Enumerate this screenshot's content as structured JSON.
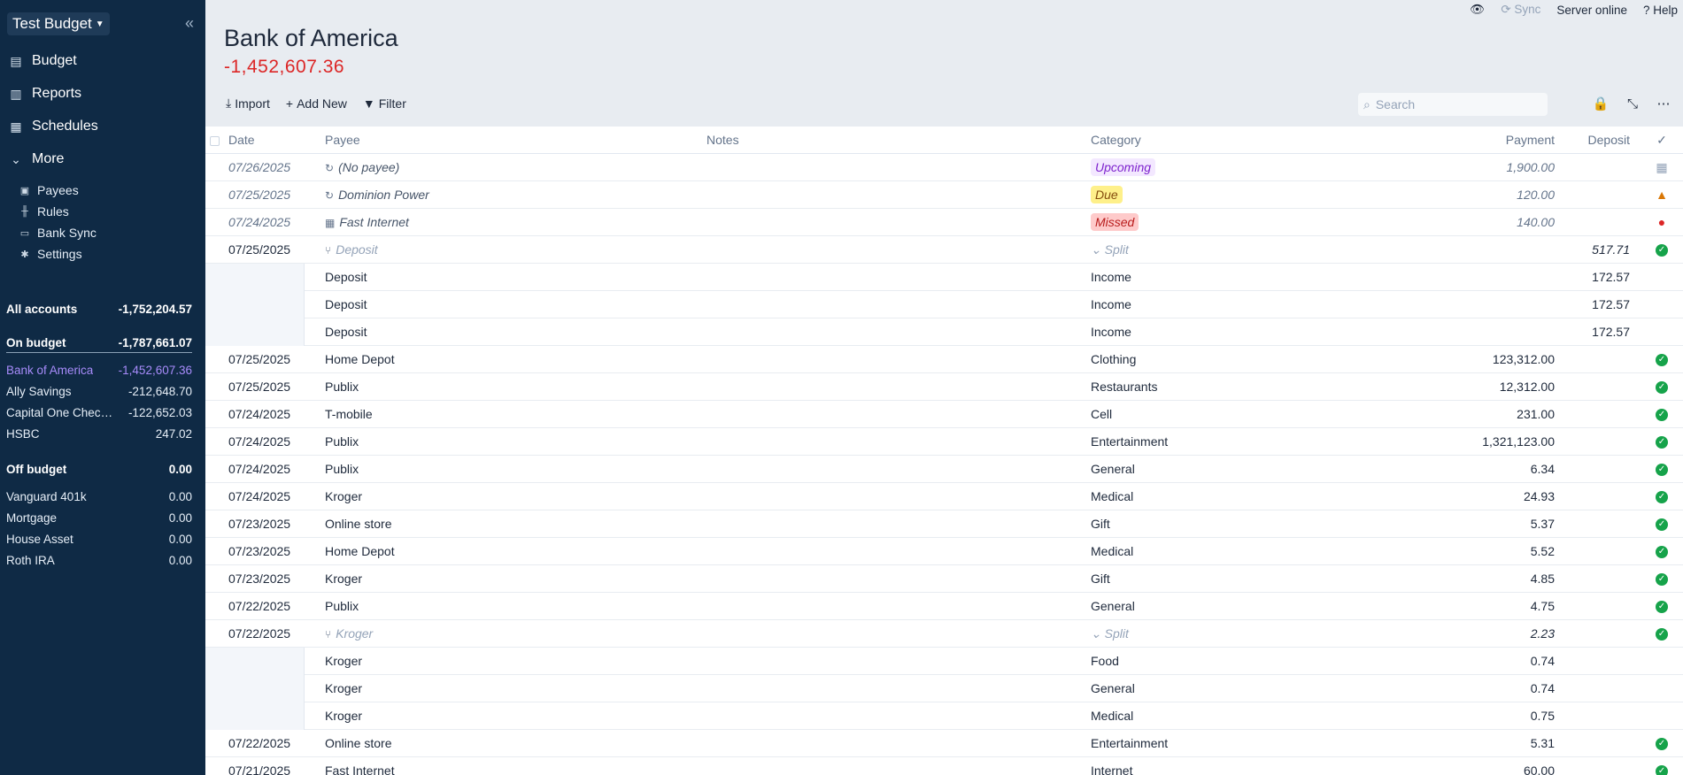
{
  "sidebar": {
    "budget_name": "Test Budget",
    "nav": [
      {
        "label": "Budget",
        "icon": "wallet-icon"
      },
      {
        "label": "Reports",
        "icon": "bar-chart-icon"
      },
      {
        "label": "Schedules",
        "icon": "calendar-icon"
      },
      {
        "label": "More",
        "icon": "chevron-down-icon"
      }
    ],
    "more_items": [
      {
        "label": "Payees",
        "icon": "payee-book-icon"
      },
      {
        "label": "Rules",
        "icon": "sliders-icon"
      },
      {
        "label": "Bank Sync",
        "icon": "credit-card-icon"
      },
      {
        "label": "Settings",
        "icon": "gear-icon"
      }
    ],
    "all_accounts": {
      "label": "All accounts",
      "value": "-1,752,204.57"
    },
    "on_budget": {
      "label": "On budget",
      "value": "-1,787,661.07"
    },
    "on_budget_accounts": [
      {
        "name": "Bank of America",
        "value": "-1,452,607.36"
      },
      {
        "name": "Ally Savings",
        "value": "-212,648.70"
      },
      {
        "name": "Capital One Checking",
        "value": "-122,652.03"
      },
      {
        "name": "HSBC",
        "value": "247.02"
      }
    ],
    "off_budget": {
      "label": "Off budget",
      "value": "0.00"
    },
    "off_budget_accounts": [
      {
        "name": "Vanguard 401k",
        "value": "0.00"
      },
      {
        "name": "Mortgage",
        "value": "0.00"
      },
      {
        "name": "House Asset",
        "value": "0.00"
      },
      {
        "name": "Roth IRA",
        "value": "0.00"
      }
    ]
  },
  "topbar": {
    "sync": "Sync",
    "server": "Server online",
    "help": "Help"
  },
  "account": {
    "title": "Bank of America",
    "balance": "-1,452,607.36"
  },
  "toolbar": {
    "import": "Import",
    "add_new": "Add New",
    "filter": "Filter",
    "search_placeholder": "Search"
  },
  "columns": {
    "date": "Date",
    "payee": "Payee",
    "notes": "Notes",
    "category": "Category",
    "payment": "Payment",
    "deposit": "Deposit",
    "cleared": "✓"
  },
  "rows": [
    {
      "kind": "sched",
      "date": "07/26/2025",
      "payee": "(No payee)",
      "pico": "↻",
      "cat_pill": "Upcoming",
      "pill_class": "upcoming",
      "payment": "1,900.00",
      "deposit": "",
      "status": "cal"
    },
    {
      "kind": "sched",
      "date": "07/25/2025",
      "payee": "Dominion Power",
      "pico": "↻",
      "cat_pill": "Due",
      "pill_class": "due",
      "payment": "120.00",
      "deposit": "",
      "status": "warn"
    },
    {
      "kind": "sched",
      "date": "07/24/2025",
      "payee": "Fast Internet",
      "pico": "▦",
      "cat_pill": "Missed",
      "pill_class": "missed",
      "payment": "140.00",
      "deposit": "",
      "status": "miss"
    },
    {
      "kind": "split",
      "date": "07/25/2025",
      "payee": "Deposit",
      "pico": "⑂",
      "category": "Split",
      "payment": "",
      "deposit": "517.71",
      "status": "ok"
    },
    {
      "kind": "child",
      "payee": "Deposit",
      "category": "Income",
      "payment": "",
      "deposit": "172.57"
    },
    {
      "kind": "child",
      "payee": "Deposit",
      "category": "Income",
      "payment": "",
      "deposit": "172.57"
    },
    {
      "kind": "child",
      "payee": "Deposit",
      "category": "Income",
      "payment": "",
      "deposit": "172.57"
    },
    {
      "kind": "normal",
      "date": "07/25/2025",
      "payee": "Home Depot",
      "category": "Clothing",
      "payment": "123,312.00",
      "deposit": "",
      "status": "ok"
    },
    {
      "kind": "normal",
      "date": "07/25/2025",
      "payee": "Publix",
      "category": "Restaurants",
      "payment": "12,312.00",
      "deposit": "",
      "status": "ok"
    },
    {
      "kind": "normal",
      "date": "07/24/2025",
      "payee": "T-mobile",
      "category": "Cell",
      "payment": "231.00",
      "deposit": "",
      "status": "ok"
    },
    {
      "kind": "normal",
      "date": "07/24/2025",
      "payee": "Publix",
      "category": "Entertainment",
      "payment": "1,321,123.00",
      "deposit": "",
      "status": "ok"
    },
    {
      "kind": "normal",
      "date": "07/24/2025",
      "payee": "Publix",
      "category": "General",
      "payment": "6.34",
      "deposit": "",
      "status": "ok"
    },
    {
      "kind": "normal",
      "date": "07/24/2025",
      "payee": "Kroger",
      "category": "Medical",
      "payment": "24.93",
      "deposit": "",
      "status": "ok"
    },
    {
      "kind": "normal",
      "date": "07/23/2025",
      "payee": "Online store",
      "category": "Gift",
      "payment": "5.37",
      "deposit": "",
      "status": "ok"
    },
    {
      "kind": "normal",
      "date": "07/23/2025",
      "payee": "Home Depot",
      "category": "Medical",
      "payment": "5.52",
      "deposit": "",
      "status": "ok"
    },
    {
      "kind": "normal",
      "date": "07/23/2025",
      "payee": "Kroger",
      "category": "Gift",
      "payment": "4.85",
      "deposit": "",
      "status": "ok"
    },
    {
      "kind": "normal",
      "date": "07/22/2025",
      "payee": "Publix",
      "category": "General",
      "payment": "4.75",
      "deposit": "",
      "status": "ok"
    },
    {
      "kind": "split",
      "date": "07/22/2025",
      "payee": "Kroger",
      "pico": "⑂",
      "category": "Split",
      "payment": "2.23",
      "deposit": "",
      "status": "ok"
    },
    {
      "kind": "child",
      "payee": "Kroger",
      "category": "Food",
      "payment": "0.74",
      "deposit": ""
    },
    {
      "kind": "child",
      "payee": "Kroger",
      "category": "General",
      "payment": "0.74",
      "deposit": ""
    },
    {
      "kind": "child",
      "payee": "Kroger",
      "category": "Medical",
      "payment": "0.75",
      "deposit": ""
    },
    {
      "kind": "normal",
      "date": "07/22/2025",
      "payee": "Online store",
      "category": "Entertainment",
      "payment": "5.31",
      "deposit": "",
      "status": "ok"
    },
    {
      "kind": "normal",
      "date": "07/21/2025",
      "payee": "Fast Internet",
      "category": "Internet",
      "payment": "60.00",
      "deposit": "",
      "status": "ok"
    }
  ]
}
